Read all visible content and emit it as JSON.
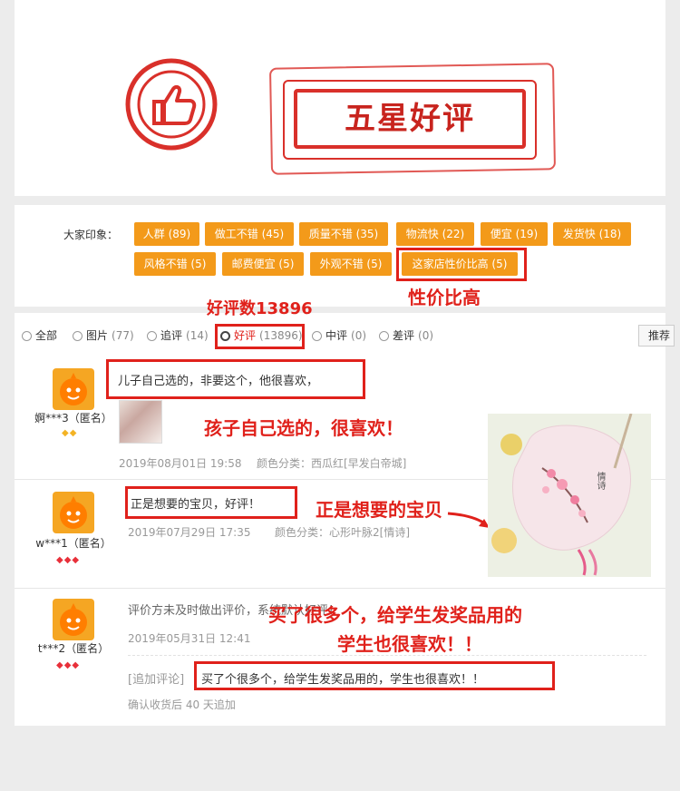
{
  "banner": {
    "title": "五星好评"
  },
  "impressions": {
    "label": "大家印象：",
    "tags": [
      "人群 (89)",
      "做工不错 (45)",
      "质量不错 (35)",
      "物流快 (22)",
      "便宜 (19)",
      "发货快 (18)",
      "风格不错 (5)",
      "邮费便宜 (5)",
      "外观不错 (5)",
      "这家店性价比高 (5)"
    ],
    "callout": "性价比高"
  },
  "filters": {
    "callout": "好评数13896",
    "items": [
      {
        "label": "全部",
        "count": ""
      },
      {
        "label": "图片",
        "count": "(77)"
      },
      {
        "label": "追评",
        "count": "(14)"
      },
      {
        "label": "好评",
        "count": "(13896)"
      },
      {
        "label": "中评",
        "count": "(0)"
      },
      {
        "label": "差评",
        "count": "(0)"
      }
    ],
    "sort_label": "推荐"
  },
  "reviews": [
    {
      "user": "婀***3（匿名）",
      "text": "儿子自己选的，非要这个，他很喜欢，",
      "date": "2019年08月01日 19:58",
      "attr": "颜色分类：西瓜红[早发白帝城]",
      "callout": "孩子自己选的，很喜欢！"
    },
    {
      "user": "w***1（匿名）",
      "text": "正是想要的宝贝，好评！",
      "date": "2019年07月29日 17:35",
      "attr": "颜色分类：心形叶脉2[情诗]",
      "callout": "正是想要的宝贝"
    },
    {
      "user": "t***2（匿名）",
      "text": "评价方未及时做出评价，系统默认好评！",
      "date": "2019年05月31日 12:41",
      "followup_label": "[追加评论]",
      "followup_text": "买了个很多个，给学生发奖品用的，学生也很喜欢！！",
      "followup_time": "确认收货后 40 天追加",
      "callout_line1": "买了很多个，给学生发奖品用的",
      "callout_line2": "学生也很喜欢！！"
    }
  ],
  "product_photo": {
    "poem_text": "情诗"
  },
  "colors": {
    "accent": "#e0211b",
    "tag": "#f39a1a"
  }
}
